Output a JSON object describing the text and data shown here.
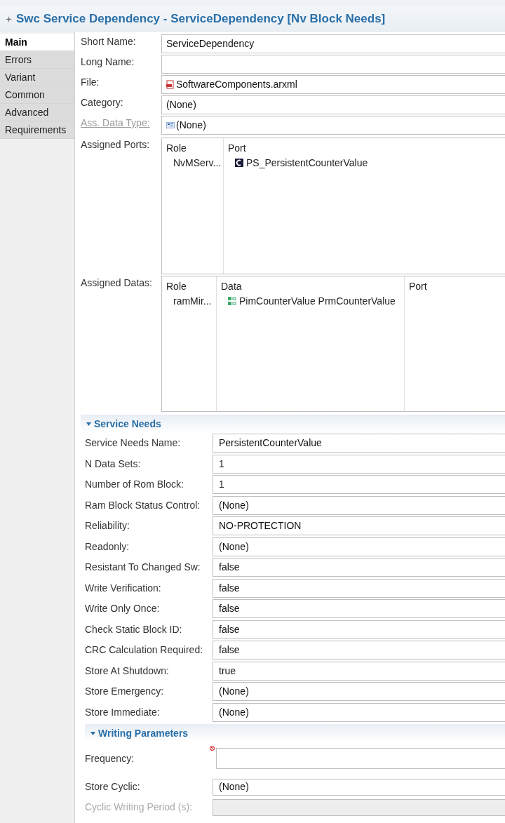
{
  "editor": {
    "title": "Swc Service Dependency - ServiceDependency [Nv Block Needs]"
  },
  "tabs": [
    {
      "label": "Main",
      "selected": true
    },
    {
      "label": "Errors",
      "selected": false
    },
    {
      "label": "Variant",
      "selected": false
    },
    {
      "label": "Common",
      "selected": false
    },
    {
      "label": "Advanced",
      "selected": false
    },
    {
      "label": "Requirements",
      "selected": false
    }
  ],
  "general_fields": [
    {
      "label": "Short Name:",
      "value": "ServiceDependency",
      "kind": "text",
      "disabled": false
    },
    {
      "label": "Long Name:",
      "kind": "text",
      "disabled": false
    },
    {
      "label": "File:",
      "value": "SoftwareComponents.arxml",
      "kind": "file",
      "disabled": false
    },
    {
      "label": "Category:",
      "value": "(None)",
      "kind": "combo",
      "disabled": false
    },
    {
      "label": "Ass. Data Type:",
      "value": "(None)",
      "kind": "type",
      "disabled": true
    }
  ],
  "assigned_ports": {
    "label": "Assigned Ports:",
    "columns": [
      "Role",
      "Port"
    ],
    "rows": [
      [
        "NvMServ...",
        "PS_PersistentCounterValue"
      ]
    ]
  },
  "assigned_datas": {
    "label": "Assigned Datas:",
    "columns": [
      "Role",
      "Data",
      "Port"
    ],
    "rows": [
      [
        "ramMir...",
        "PimCounterValue PrmCounterValue",
        null
      ]
    ]
  },
  "service_needs": {
    "title": "Service Needs",
    "expanded": true,
    "fields": [
      {
        "label": "Service Needs Name:",
        "value": "PersistentCounterValue",
        "disabled": false
      },
      {
        "label": "N Data Sets:",
        "value": "1",
        "disabled": false
      },
      {
        "label": "Number of Rom Block:",
        "value": "1",
        "disabled": false
      },
      {
        "label": "Ram Block Status Control:",
        "value": "(None)",
        "disabled": false
      },
      {
        "label": "Reliability:",
        "value": "NO-PROTECTION",
        "disabled": false
      },
      {
        "label": "Readonly:",
        "value": "(None)",
        "disabled": false
      },
      {
        "label": "Resistant To Changed Sw:",
        "value": "false",
        "disabled": false
      },
      {
        "label": "Write Verification:",
        "value": "false",
        "disabled": false
      },
      {
        "label": "Write Only Once:",
        "value": "false",
        "disabled": false
      },
      {
        "label": "Check Static Block ID:",
        "value": "false",
        "disabled": false
      },
      {
        "label": "CRC Calculation Required:",
        "value": "false",
        "disabled": false
      },
      {
        "label": "Store At Shutdown:",
        "value": "true",
        "disabled": false
      },
      {
        "label": "Store Emergency:",
        "value": "(None)",
        "disabled": false
      },
      {
        "label": "Store Immediate:",
        "value": "(None)",
        "disabled": false
      }
    ]
  },
  "writing_parameters": {
    "title": "Writing Parameters",
    "expanded": true,
    "fields": [
      {
        "label": "Frequency:",
        "error": true,
        "disabled": false
      },
      {
        "label": "Store Cyclic:",
        "value": "(None)",
        "disabled": false
      },
      {
        "label": "Cyclic Writing Period (s):",
        "disabled": true
      }
    ]
  }
}
